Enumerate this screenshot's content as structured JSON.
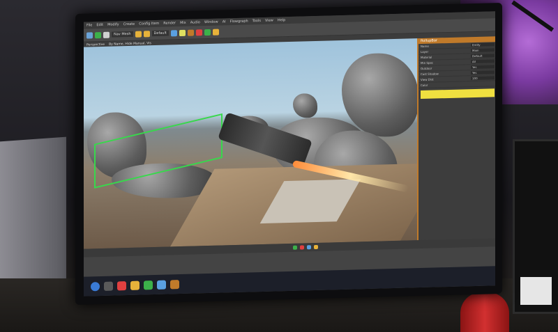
{
  "app": {
    "menu": [
      "File",
      "Edit",
      "Modify",
      "Create",
      "Config Item",
      "Render",
      "Mix",
      "Audio",
      "Window",
      "AI",
      "Flowgraph",
      "Tools",
      "View",
      "Help"
    ],
    "toolbar_field": "Nav Mesh",
    "layer_field": "Default",
    "subbar_labels": [
      "Perspective",
      "By Name, Hide Manual, Vis"
    ]
  },
  "panel": {
    "title": "RollupBar",
    "properties": [
      {
        "label": "Name",
        "value": "Entity"
      },
      {
        "label": "Layer",
        "value": "Main"
      },
      {
        "label": "Material",
        "value": "Default"
      },
      {
        "label": "Min Spec",
        "value": "All"
      },
      {
        "label": "Outdoor",
        "value": "Yes"
      },
      {
        "label": "Cast Shadow",
        "value": "Yes"
      },
      {
        "label": "View Dist",
        "value": "100"
      }
    ],
    "color_label": "Color"
  },
  "colors": {
    "accent": "#c07a2a",
    "gizmo": "#38d84c",
    "beam": "#ffe6a8"
  }
}
